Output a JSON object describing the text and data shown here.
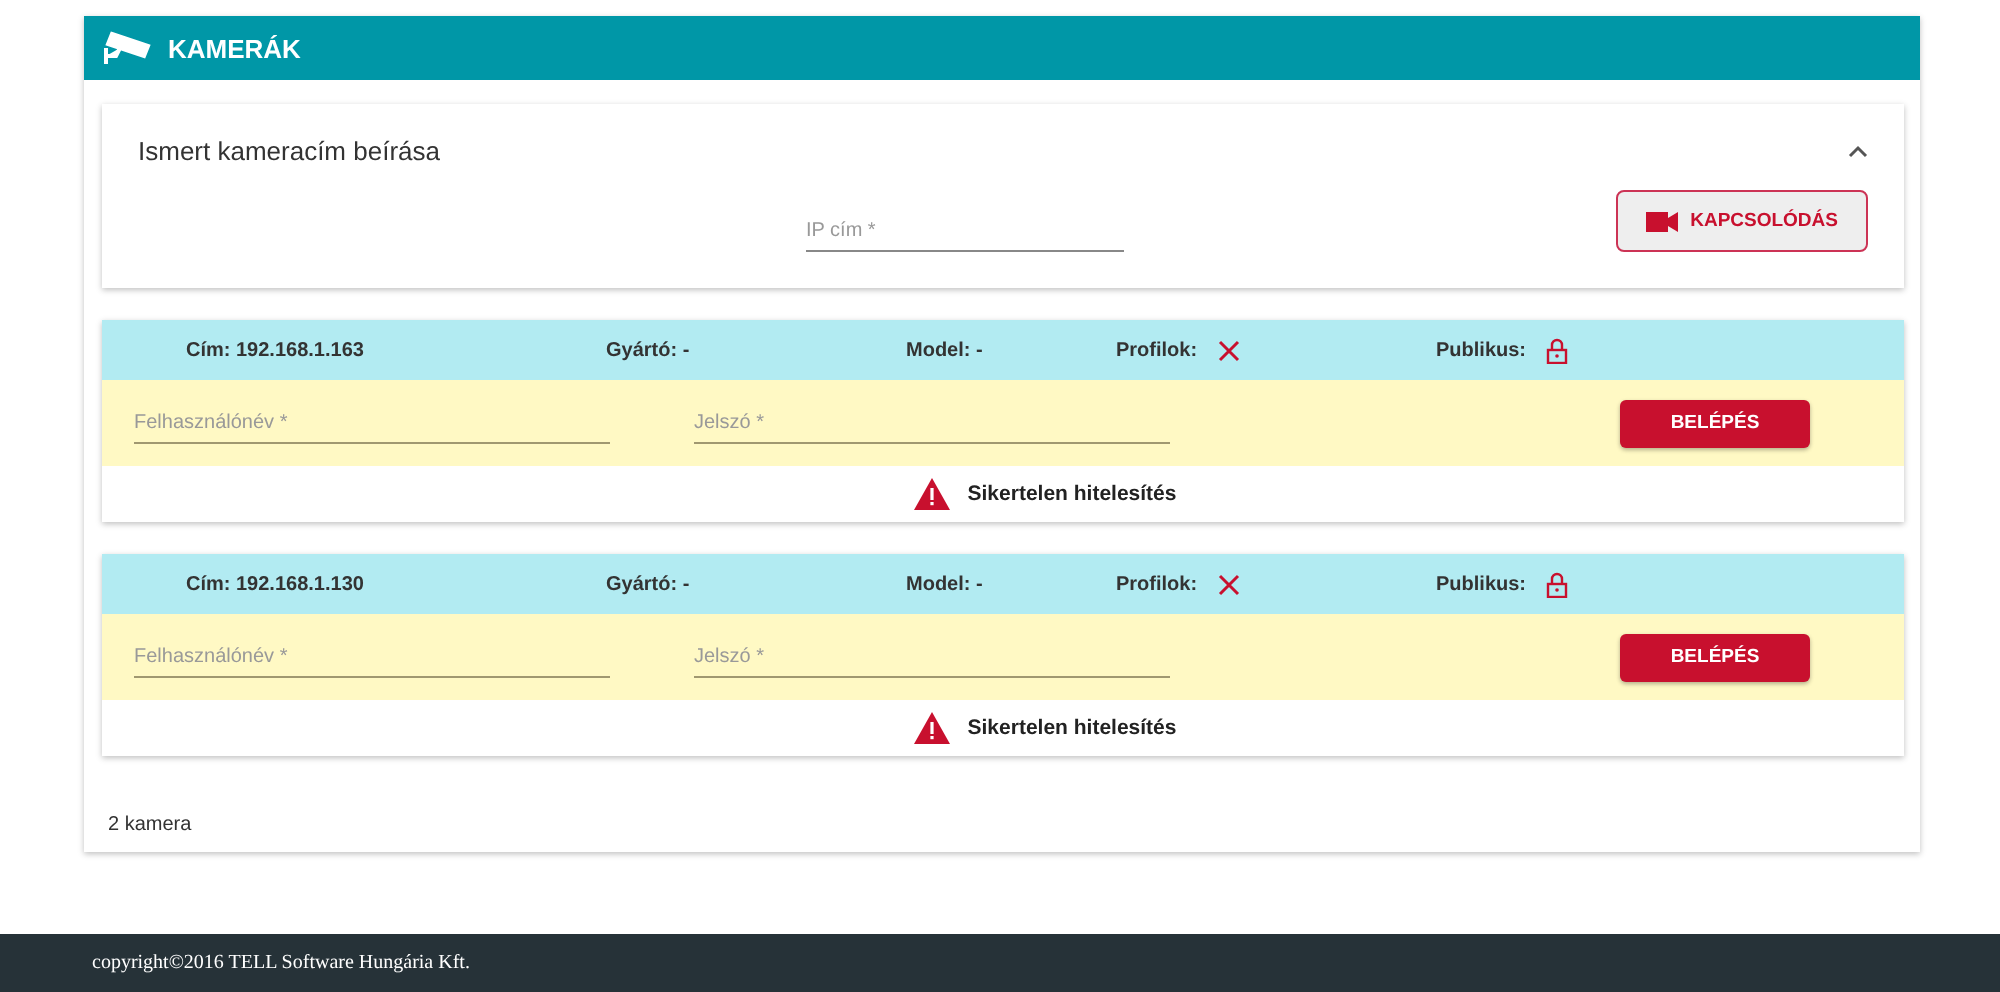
{
  "header": {
    "title": "KAMERÁK"
  },
  "manual_entry": {
    "title": "Ismert kameracím beírása",
    "expanded": true,
    "ip_field": {
      "placeholder": "IP cím *"
    },
    "connect_button": "KAPCSOLÓDÁS"
  },
  "cameras": [
    {
      "address": "Cím: 192.168.1.163",
      "manufacturer": "Gyártó: -",
      "model": "Model: -",
      "profiles_label": "Profilok:",
      "profiles": false,
      "public_label": "Publikus:",
      "username": {
        "placeholder": "Felhasználónév *"
      },
      "password": {
        "placeholder": "Jelszó *"
      },
      "login_button": "BELÉPÉS",
      "error": "Sikertelen hitelesítés"
    },
    {
      "address": "Cím: 192.168.1.130",
      "manufacturer": "Gyártó: -",
      "model": "Model: -",
      "profiles_label": "Profilok:",
      "profiles": false,
      "public_label": "Publikus:",
      "username": {
        "placeholder": "Felhasználónév *"
      },
      "password": {
        "placeholder": "Jelszó *"
      },
      "login_button": "BELÉPÉS",
      "error": "Sikertelen hitelesítés"
    }
  ],
  "count": "2 kamera",
  "footer": "copyright©2016 TELL Software Hungária Kft."
}
